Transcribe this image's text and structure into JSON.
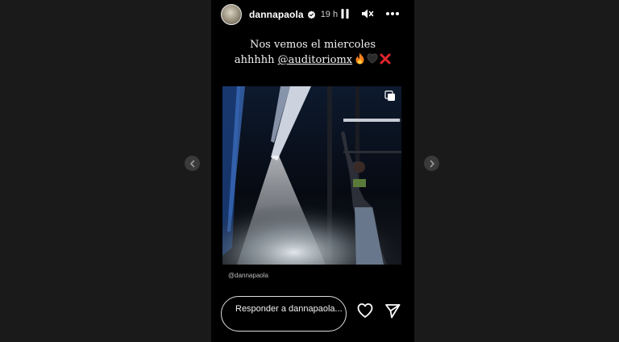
{
  "story": {
    "username": "dannapaola",
    "verified": true,
    "time": "19 h"
  },
  "caption": {
    "line1": "Nos vemos el miercoles",
    "line2_prefix": "ahhhhh",
    "mention": "@auditoriomx",
    "emojis": [
      "fire-emoji",
      "black-heart-emoji",
      "red-x-emoji"
    ]
  },
  "photo": {
    "credit": "@dannapaola"
  },
  "reply": {
    "placeholder": "Responder a dannapaola..."
  },
  "icons": {
    "pause": "pause-icon",
    "mute": "speaker-muted-icon",
    "more": "more-horizontal-icon",
    "like": "heart-outline-icon",
    "share": "paper-plane-icon",
    "prev": "chevron-left-icon",
    "next": "chevron-right-icon"
  },
  "colors": {
    "background": "#1a1a1a",
    "story_bg": "#000000",
    "verified": "#ffffff"
  }
}
